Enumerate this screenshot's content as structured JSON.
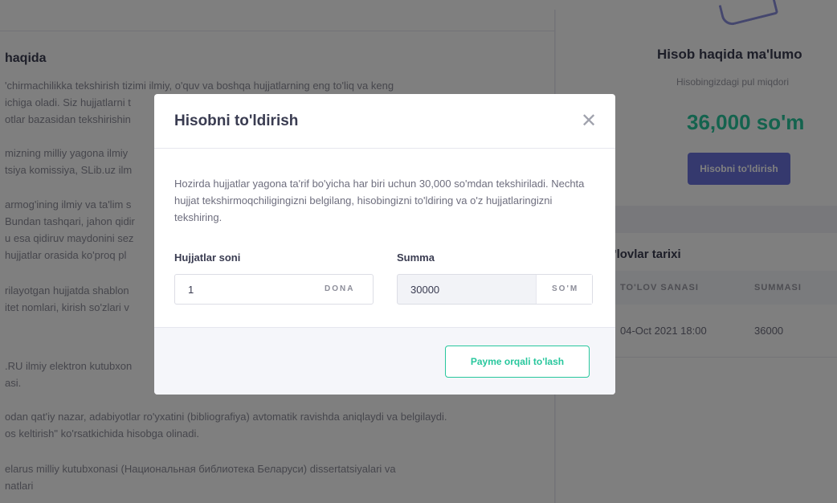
{
  "background": {
    "section_title": "haqida",
    "paragraphs": [
      [
        "'chirmachilikka tekshirish tizimi ilmiy, o'quv va boshqa hujjatlarning eng to'liq va keng",
        "ichiga oladi. Siz hujjatlarni t",
        "otlar bazasidan tekshirishin"
      ],
      [
        "mizning milliy yagona ilmiy",
        "tsiya komissiya, SLib.uz ilm"
      ],
      [
        "armog'ining ilmiy va ta'lim s",
        "Bundan tashqari, jahon qidir",
        "u esa qidiruv maydonini sez",
        "hujjatlar orasida ko'proq pl"
      ],
      [
        "rilayotgan hujjatda shablon",
        "itet nomlari, kirish so'zlari v"
      ],
      [
        ".RU ilmiy elektron kutubxon",
        "asi."
      ],
      [
        "odan qat'iy nazar, adabiyotlar ro'yxatini (bibliografiya) avtomatik ravishda aniqlaydi va belgilaydi.",
        "os keltirish\" ko'rsatkichida hisobga olinadi."
      ],
      [
        "elarus milliy kutubxonasi (Национальная библиотека Беларуси) dissertatsiyalari va",
        "natlari"
      ]
    ],
    "account": {
      "title": "Hisob haqida ma'lumo",
      "subtitle": "Hisobingizdagi pul miqdori",
      "balance": "36,000 so'm",
      "topup_button": "Hisobni to'ldirish"
    },
    "history": {
      "title": "'lovlar tarixi",
      "columns": [
        "TO'LOV SANASI",
        "SUMMASI"
      ],
      "rows": [
        [
          "04-Oct 2021 18:00",
          "36000"
        ]
      ]
    }
  },
  "modal": {
    "title": "Hisobni to'ldirish",
    "close_icon": "close-icon",
    "description": "Hozirda hujjatlar yagona ta'rif bo'yicha har biri uchun 30,000 so'mdan tekshiriladi. Nechta hujjat tekshirmoqchiligingizni belgilang, hisobingizni to'ldiring va o'z hujjatlaringizni tekshiring.",
    "count_label": "Hujjatlar soni",
    "count_value": "1",
    "count_unit": "DONA",
    "sum_label": "Summa",
    "sum_value": "30000",
    "sum_unit": "SO'M",
    "pay_button": "Payme orqali to'lash"
  },
  "colors": {
    "accent_green": "#28c79d",
    "accent_blue": "#6a72dc"
  }
}
